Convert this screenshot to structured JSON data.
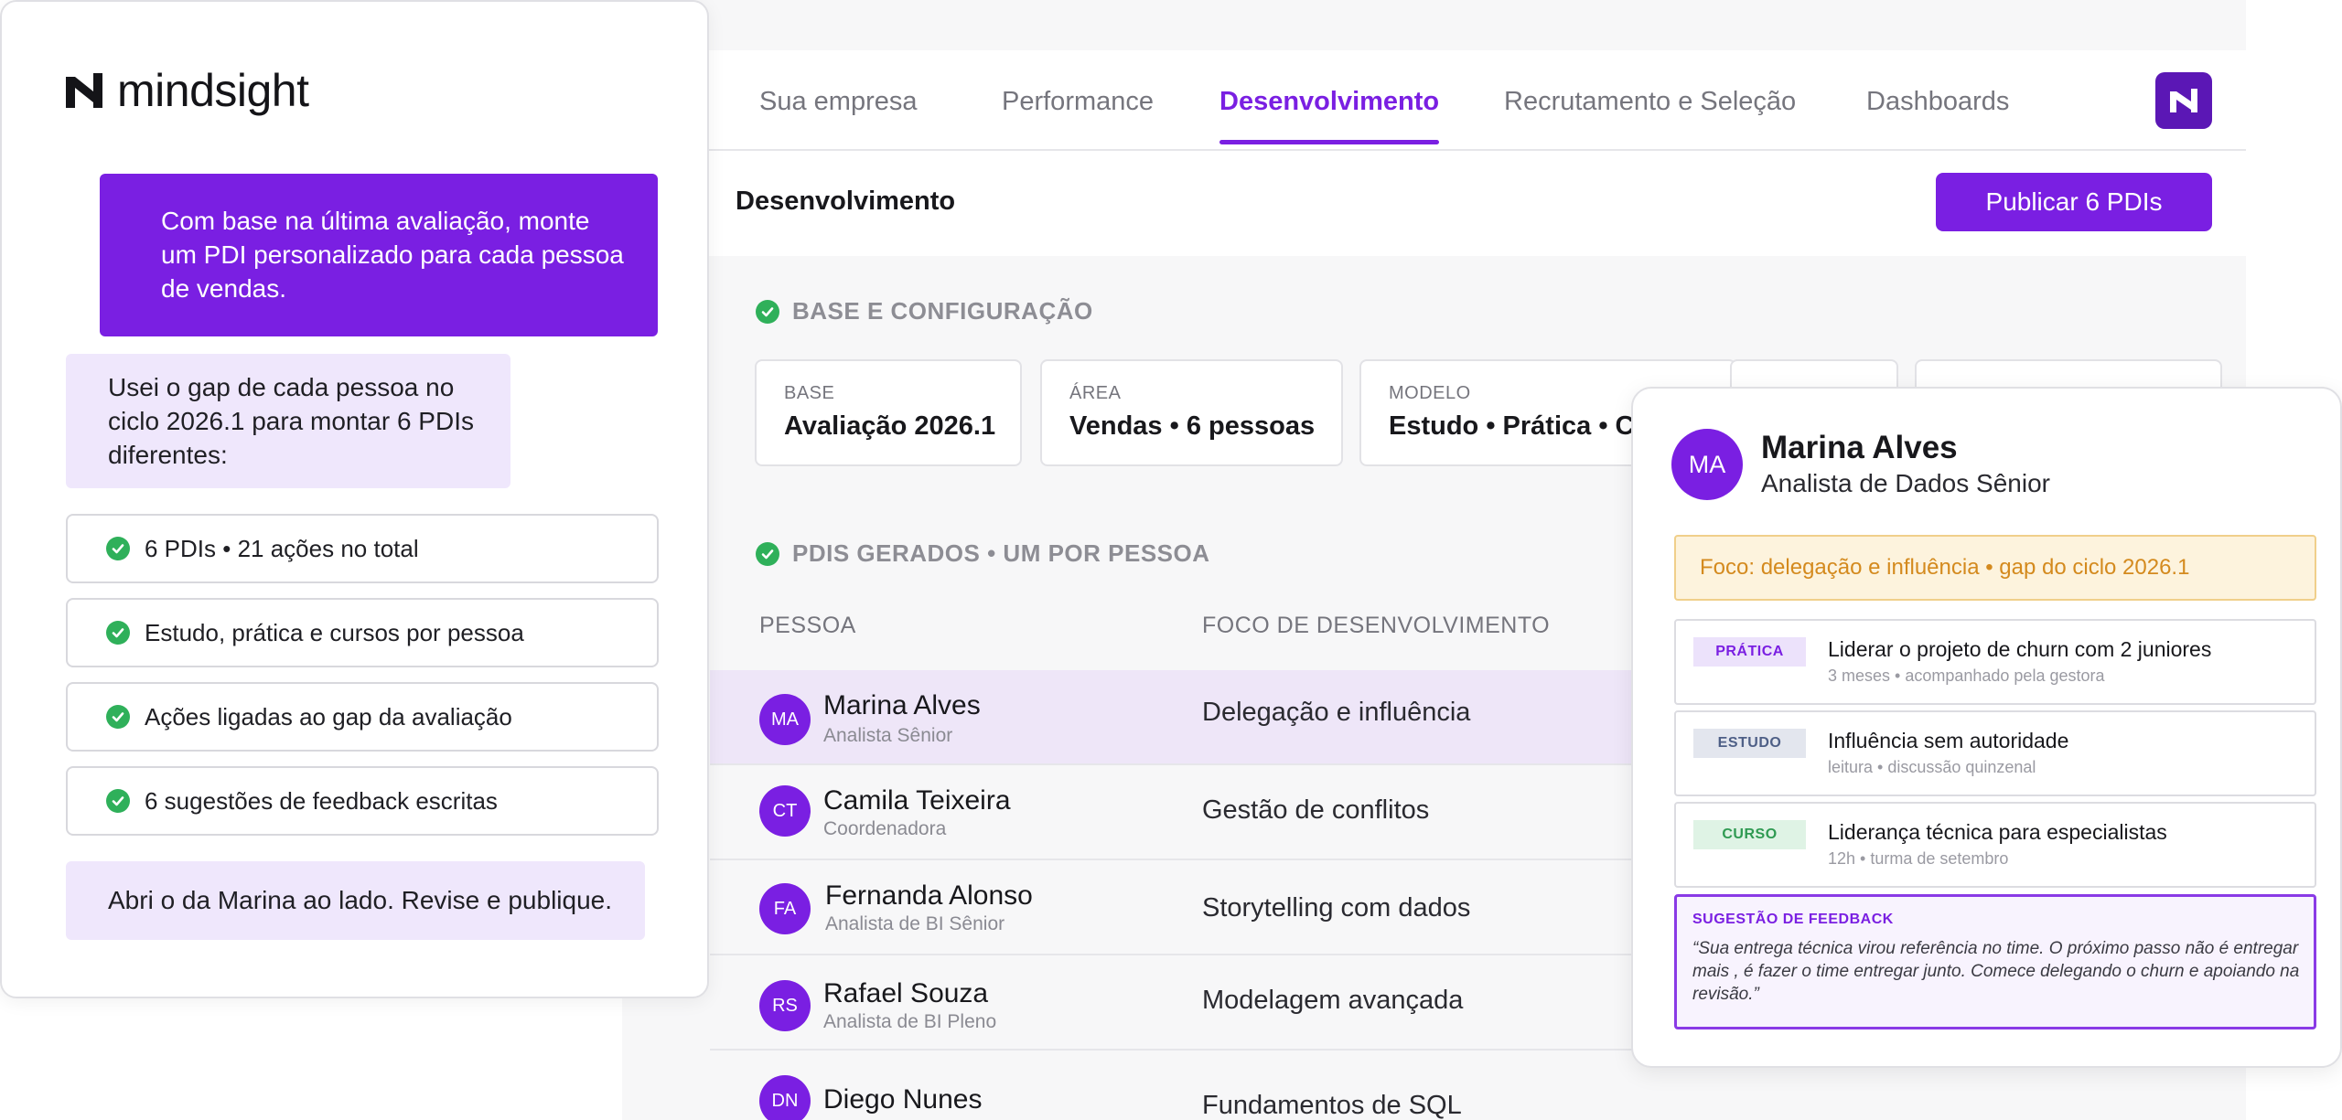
{
  "nav": {
    "tabs": [
      {
        "label": "Sua empresa"
      },
      {
        "label": "Performance"
      },
      {
        "label": "Desenvolvimento"
      },
      {
        "label": "Recrutamento e Seleção"
      },
      {
        "label": "Dashboards"
      }
    ],
    "active_tab": "Desenvolvimento"
  },
  "header": {
    "title": "Desenvolvimento",
    "publish_label": "Publicar 6 PDIs"
  },
  "config": {
    "section_title": "BASE E CONFIGURAÇÃO",
    "cards": [
      {
        "label": "BASE",
        "value": "Avaliação 2026.1"
      },
      {
        "label": "ÁREA",
        "value": "Vendas • 6 pessoas"
      },
      {
        "label": "MODELO",
        "value": "Estudo • Prática • Cursos"
      }
    ]
  },
  "table": {
    "section_title": "PDIS GERADOS • UM POR PESSOA",
    "col_person": "PESSOA",
    "col_focus": "FOCO DE DESENVOLVIMENTO",
    "rows": [
      {
        "initials": "MA",
        "name": "Marina Alves",
        "role": "Analista Sênior",
        "focus": "Delegação e influência"
      },
      {
        "initials": "CT",
        "name": "Camila Teixeira",
        "role": "Coordenadora",
        "focus": "Gestão de conflitos"
      },
      {
        "initials": "FA",
        "name": "Fernanda Alonso",
        "role": "Analista de BI Sênior",
        "focus": "Storytelling com dados"
      },
      {
        "initials": "RS",
        "name": "Rafael Souza",
        "role": "Analista de BI Pleno",
        "focus": "Modelagem avançada"
      },
      {
        "initials": "DN",
        "name": "Diego Nunes",
        "role": "",
        "focus": "Fundamentos de SQL"
      }
    ]
  },
  "chat": {
    "brand": "mindsight",
    "user_message": "Com base na última avaliação, monte um PDI personalizado para cada pessoa de vendas.",
    "bot_intro": "Usei o gap de cada pessoa no ciclo 2026.1 para montar 6 PDIs diferentes:",
    "checks": [
      "6 PDIs • 21 ações no total",
      "Estudo, prática e cursos por pessoa",
      "Ações ligadas ao gap da avaliação",
      "6 sugestões de feedback escritas"
    ],
    "bot_outro": "Abri o da Marina ao lado. Revise e publique."
  },
  "detail": {
    "initials": "MA",
    "name": "Marina Alves",
    "role": "Analista de Dados Sênior",
    "focus": "Foco: delegação e influência • gap do ciclo 2026.1",
    "actions": [
      {
        "tag": "PRÁTICA",
        "title": "Liderar o projeto de churn com 2 juniores",
        "sub": "3 meses • acompanhado pela gestora"
      },
      {
        "tag": "ESTUDO",
        "title": "Influência sem autoridade",
        "sub": "leitura • discussão quinzenal"
      },
      {
        "tag": "CURSO",
        "title": "Liderança técnica para especialistas",
        "sub": "12h • turma de setembro"
      }
    ],
    "feedback_label": "SUGESTÃO DE FEEDBACK",
    "feedback_text": "“Sua entrega técnica virou referência no time. O próximo passo não é entregar mais , é fazer o time entregar junto. Comece delegando o churn e apoiando na revisão.”"
  },
  "colors": {
    "accent": "#7a1fe2",
    "success": "#2fb05a",
    "focus_bg": "#fdf3dd",
    "focus_text": "#d48a1e"
  },
  "icons": [
    "mindsight-logo-icon",
    "check-circle-icon",
    "app-logo-icon"
  ]
}
